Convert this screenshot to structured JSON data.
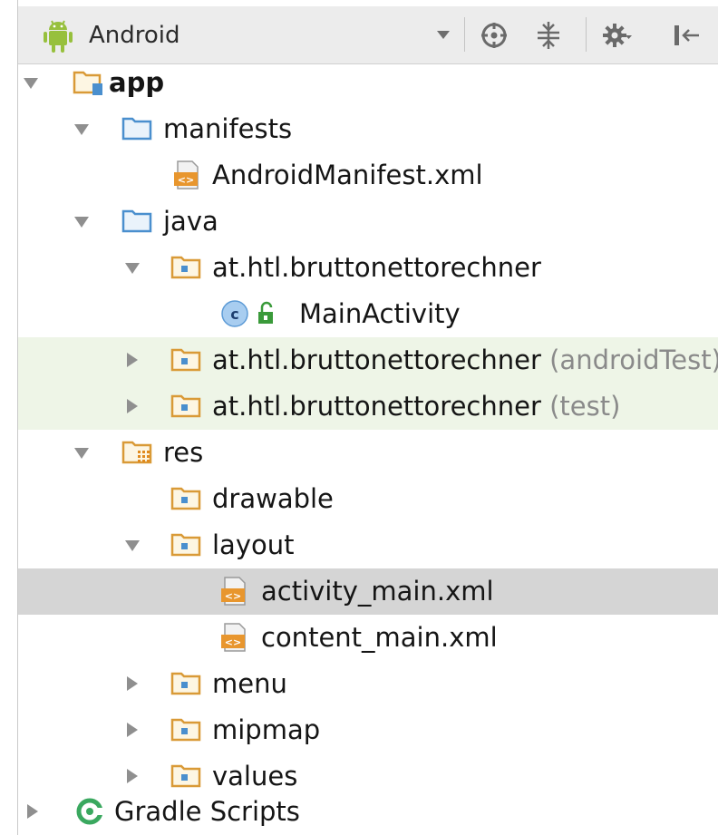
{
  "toolbar": {
    "view_label": "Android",
    "icons": [
      "locate-icon",
      "collapse-icon",
      "gear-icon",
      "hide-icon"
    ]
  },
  "tree": {
    "app": "app",
    "manifests": "manifests",
    "manifest_file": "AndroidManifest.xml",
    "java": "java",
    "pkg_main": "at.htl.bruttonettorechner",
    "main_activity": "MainActivity",
    "pkg_android_test": "at.htl.bruttonettorechner",
    "pkg_android_test_suffix": "(androidTest)",
    "pkg_test": "at.htl.bruttonettorechner",
    "pkg_test_suffix": "(test)",
    "res": "res",
    "drawable": "drawable",
    "layout": "layout",
    "activity_main": "activity_main.xml",
    "content_main": "content_main.xml",
    "menu": "menu",
    "mipmap": "mipmap",
    "values": "values",
    "gradle_scripts": "Gradle Scripts"
  },
  "colors": {
    "folder_blue": "#4a8fce",
    "folder_orange": "#d99a37",
    "android_green": "#97c03d",
    "gradle_green": "#3aa85f",
    "test_row_bg": "#eef5e7",
    "selected_row_bg": "#d5d5d5"
  },
  "selected_item": "activity_main.xml"
}
